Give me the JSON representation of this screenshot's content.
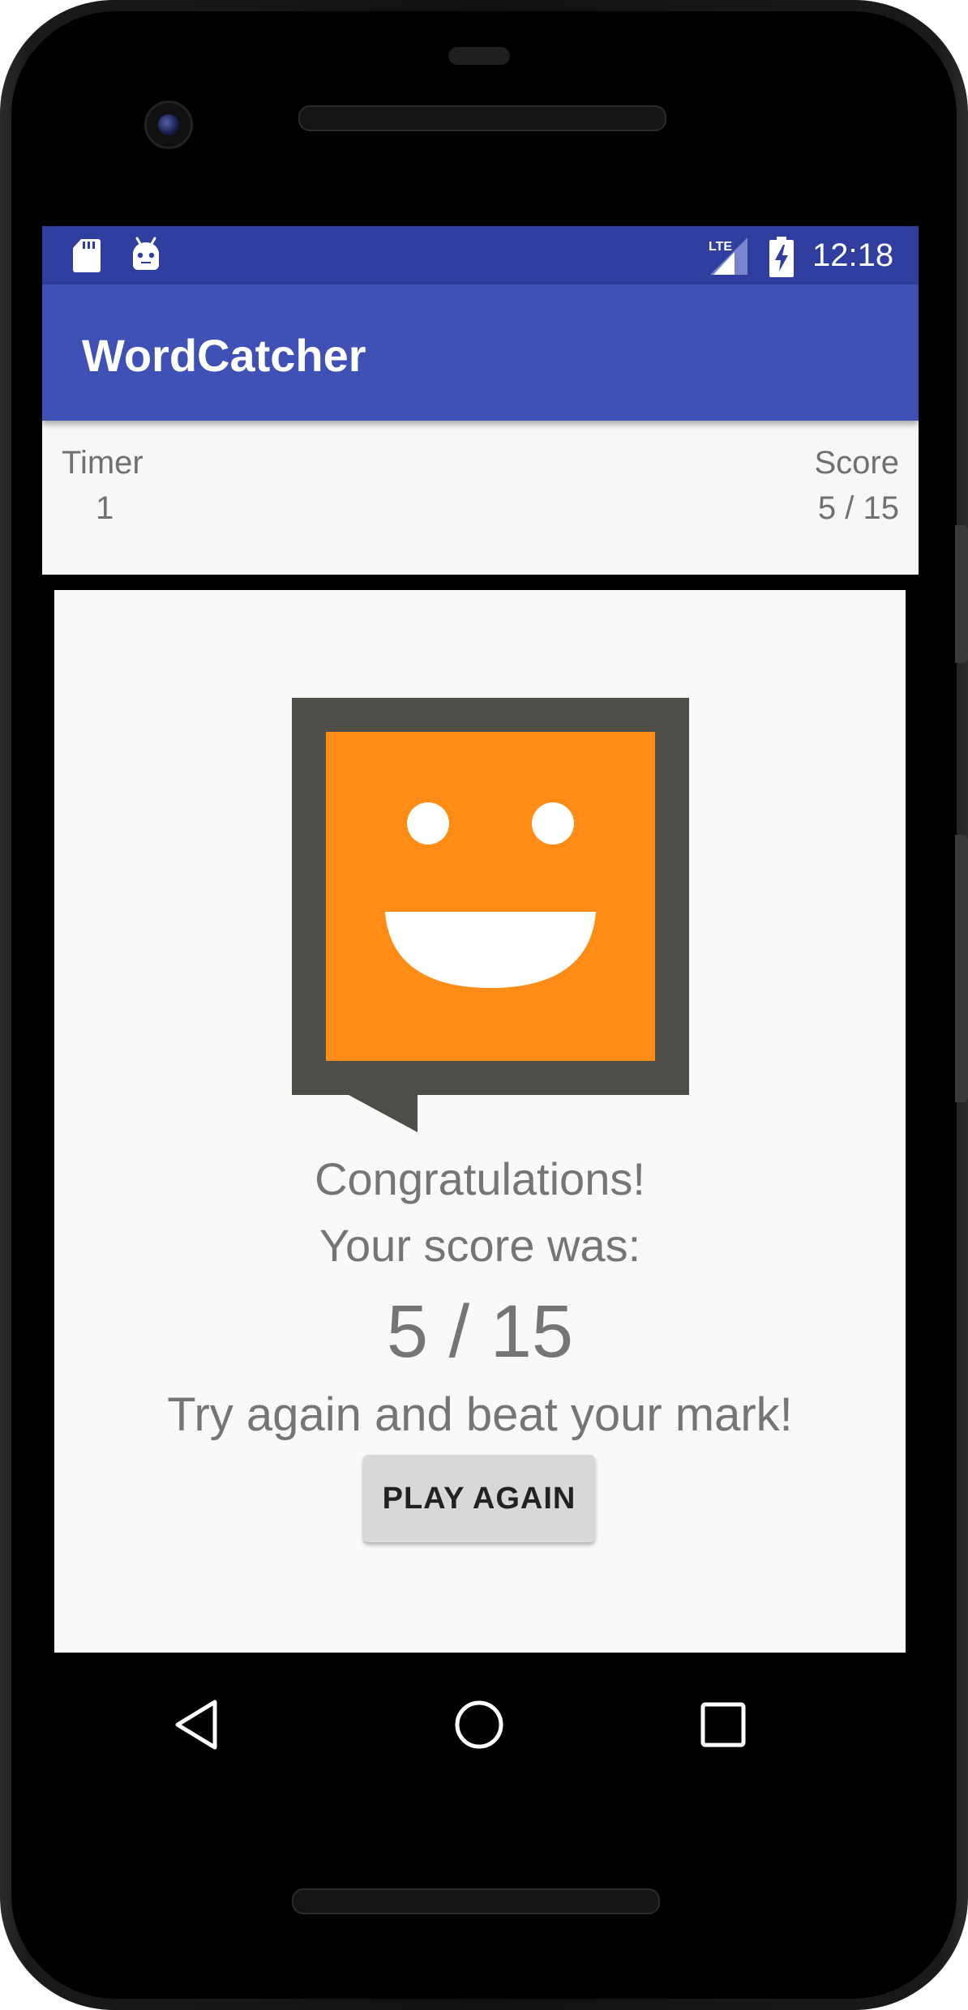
{
  "device": {
    "frame_color": "#141414"
  },
  "status_bar": {
    "background": "#303f9f",
    "time": "12:18",
    "network": "LTE",
    "icons": [
      "sd-card-icon",
      "android-debug-icon",
      "lte-signal-icon",
      "battery-charging-icon"
    ]
  },
  "app_bar": {
    "title": "WordCatcher",
    "background": "#3f51b5"
  },
  "stats": {
    "timer_label": "Timer",
    "timer_value": "1",
    "score_label": "Score",
    "score_value": "5 / 15"
  },
  "result": {
    "image_icon": "smiley-speech-bubble-icon",
    "line1": "Congratulations!",
    "line2": "Your score was:",
    "score": "5 / 15",
    "encouragement": "Try again and beat your mark!",
    "play_again_label": "PLAY AGAIN",
    "accent_orange": "#ff8c16",
    "frame_gray": "#4e4d47"
  },
  "nav_bar": {
    "icons": [
      "back-icon",
      "home-icon",
      "recents-icon"
    ]
  }
}
